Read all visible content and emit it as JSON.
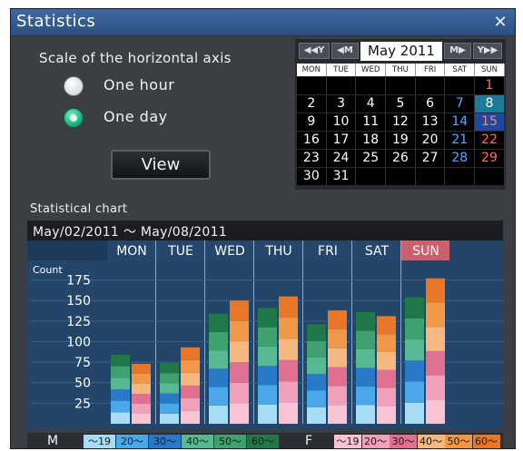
{
  "window": {
    "title": "Statistics",
    "close_glyph": "✕"
  },
  "scale": {
    "label": "Scale of the horizontal axis",
    "options": [
      {
        "label": "One hour",
        "selected": false
      },
      {
        "label": "One day",
        "selected": true
      }
    ],
    "view_button": "View"
  },
  "calendar": {
    "month": "May 2011",
    "nav": {
      "prev_year": "◀◀Y",
      "prev_month": "◀M",
      "next_month": "M▶",
      "next_year": "Y▶▶"
    },
    "weekdays": [
      "MON",
      "TUE",
      "WED",
      "THU",
      "FRI",
      "SAT",
      "SUN"
    ],
    "weeks": [
      [
        "",
        "",
        "",
        "",
        "",
        "",
        "1"
      ],
      [
        "2",
        "3",
        "4",
        "5",
        "6",
        "7",
        "8"
      ],
      [
        "9",
        "10",
        "11",
        "12",
        "13",
        "14",
        "15"
      ],
      [
        "16",
        "17",
        "18",
        "19",
        "20",
        "21",
        "22"
      ],
      [
        "23",
        "24",
        "25",
        "26",
        "27",
        "28",
        "29"
      ],
      [
        "30",
        "31",
        "",
        "",
        "",
        "",
        ""
      ]
    ]
  },
  "chart": {
    "section_label": "Statistical chart",
    "range": "May/02/2011 ～ May/08/2011"
  },
  "chart_data": {
    "type": "bar",
    "categories": [
      "MON",
      "TUE",
      "WED",
      "THU",
      "FRI",
      "SAT",
      "SUN"
    ],
    "ylabel": "Count",
    "ylim": [
      0,
      190
    ],
    "yticks": [
      25,
      50,
      75,
      100,
      125,
      150,
      175
    ],
    "series": [
      {
        "name": "M",
        "totals": [
          84,
          74,
          134,
          141,
          121,
          136,
          154
        ]
      },
      {
        "name": "F",
        "totals": [
          73,
          93,
          150,
          155,
          138,
          131,
          177
        ]
      }
    ],
    "age_bands": [
      "～19",
      "20～",
      "30～",
      "40～",
      "50～",
      "60～"
    ],
    "colors": {
      "M": [
        "#a8dcf4",
        "#4aa8e8",
        "#2a78c8",
        "#58b894",
        "#40a070",
        "#207848"
      ],
      "F": [
        "#f8c4d4",
        "#f0a0b8",
        "#e07090",
        "#f4b880",
        "#f09848",
        "#e87828"
      ]
    }
  },
  "legend": {
    "male_label": "M",
    "female_label": "F",
    "male_bands": [
      "～19",
      "20～",
      "30～",
      "40～",
      "50～",
      "60～"
    ],
    "female_bands": [
      "～19",
      "20～",
      "30～",
      "40～",
      "50～",
      "60～"
    ]
  }
}
